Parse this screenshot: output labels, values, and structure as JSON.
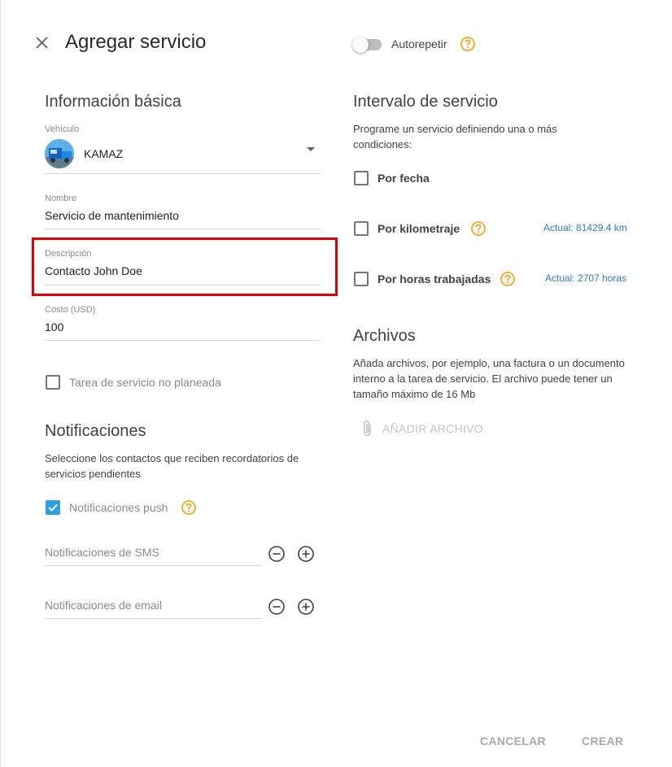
{
  "header": {
    "title": "Agregar servicio",
    "autorepeat_label": "Autorepetir"
  },
  "basic_info": {
    "section_title": "Información básica",
    "vehicle": {
      "label": "Vehículo",
      "value": "KAMAZ"
    },
    "name": {
      "label": "Nombre",
      "value": "Servicio de mantenimiento"
    },
    "description": {
      "label": "Descripción",
      "value": "Contacto John Doe"
    },
    "cost": {
      "label": "Costo (USD)",
      "value": "100"
    },
    "unplanned_label": "Tarea de servicio no planeada"
  },
  "notifications": {
    "section_title": "Notificaciones",
    "description": "Seleccione los contactos que reciben recordatorios de servicios pendientes",
    "push_label": "Notificaciones push",
    "push_checked": true,
    "sms_placeholder": "Notificaciones de SMS",
    "email_placeholder": "Notificaciones de email"
  },
  "service_interval": {
    "section_title": "Intervalo de servicio",
    "description": "Programe un servicio definiendo una o más condiciones:",
    "by_date_label": "Por fecha",
    "by_mileage_label": "Por kilometraje",
    "mileage_actual": "Actual: 81429.4 km",
    "by_hours_label": "Por horas trabajadas",
    "hours_actual": "Actual: 2707 horas"
  },
  "files": {
    "section_title": "Archivos",
    "description": "Añada archivos, por ejemplo, una factura o un documento interno a la tarea de servicio. El archivo puede tener un tamaño máximo de 16 Mb",
    "add_button_label": "AÑADIR ARCHIVO"
  },
  "footer": {
    "cancel_label": "CANCELAR",
    "create_label": "CREAR"
  },
  "colors": {
    "accent": "#2b9fe0",
    "help": "#f5a623",
    "link": "#3079c6",
    "highlight": "#e00000"
  }
}
